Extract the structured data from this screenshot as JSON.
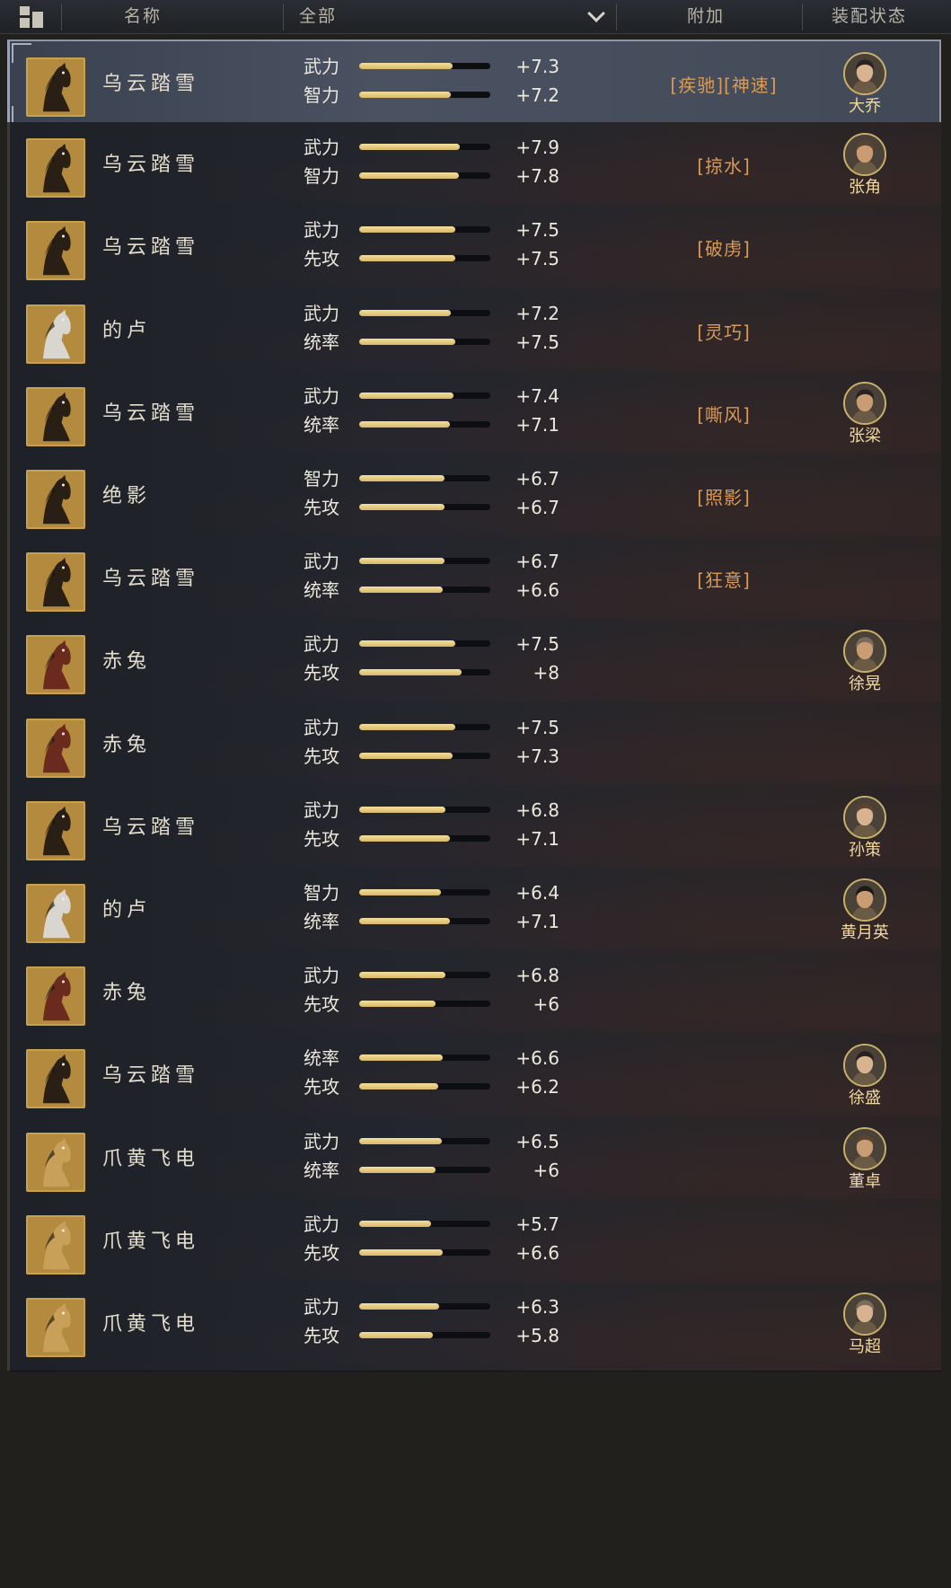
{
  "header": {
    "name_col": "名称",
    "filter_value": "全部",
    "bonus_col": "附加",
    "equip_col": "装配状态"
  },
  "horse_palette": {
    "dark": "#2a1f14",
    "white": "#d9d6cf",
    "red": "#6b2a1e",
    "yellow": "#c9a05a"
  },
  "rows": [
    {
      "name": "乌云踏雪",
      "type": "dark",
      "selected": true,
      "s1": {
        "label": "武力",
        "value": "+7.3",
        "level": 0.71
      },
      "s2": {
        "label": "智力",
        "value": "+7.2",
        "level": 0.7
      },
      "bonus": "[疾驰][神速]",
      "general": "大乔"
    },
    {
      "name": "乌云踏雪",
      "type": "dark",
      "s1": {
        "label": "武力",
        "value": "+7.9",
        "level": 0.77
      },
      "s2": {
        "label": "智力",
        "value": "+7.8",
        "level": 0.76
      },
      "bonus": "[掠水]",
      "general": "张角"
    },
    {
      "name": "乌云踏雪",
      "type": "dark",
      "s1": {
        "label": "武力",
        "value": "+7.5",
        "level": 0.73
      },
      "s2": {
        "label": "先攻",
        "value": "+7.5",
        "level": 0.73
      },
      "bonus": "[破虏]",
      "general": ""
    },
    {
      "name": "的卢",
      "type": "white",
      "s1": {
        "label": "武力",
        "value": "+7.2",
        "level": 0.7
      },
      "s2": {
        "label": "统率",
        "value": "+7.5",
        "level": 0.73
      },
      "bonus": "[灵巧]",
      "general": ""
    },
    {
      "name": "乌云踏雪",
      "type": "dark",
      "s1": {
        "label": "武力",
        "value": "+7.4",
        "level": 0.72
      },
      "s2": {
        "label": "统率",
        "value": "+7.1",
        "level": 0.69
      },
      "bonus": "[嘶风]",
      "general": "张梁"
    },
    {
      "name": "绝影",
      "type": "dark",
      "s1": {
        "label": "智力",
        "value": "+6.7",
        "level": 0.65
      },
      "s2": {
        "label": "先攻",
        "value": "+6.7",
        "level": 0.65
      },
      "bonus": "[照影]",
      "general": ""
    },
    {
      "name": "乌云踏雪",
      "type": "dark",
      "s1": {
        "label": "武力",
        "value": "+6.7",
        "level": 0.65
      },
      "s2": {
        "label": "统率",
        "value": "+6.6",
        "level": 0.64
      },
      "bonus": "[狂意]",
      "general": ""
    },
    {
      "name": "赤兔",
      "type": "red",
      "s1": {
        "label": "武力",
        "value": "+7.5",
        "level": 0.73
      },
      "s2": {
        "label": "先攻",
        "value": "+8",
        "level": 0.78
      },
      "bonus": "",
      "general": "徐晃"
    },
    {
      "name": "赤兔",
      "type": "red",
      "s1": {
        "label": "武力",
        "value": "+7.5",
        "level": 0.73
      },
      "s2": {
        "label": "先攻",
        "value": "+7.3",
        "level": 0.71
      },
      "bonus": "",
      "general": ""
    },
    {
      "name": "乌云踏雪",
      "type": "dark",
      "s1": {
        "label": "武力",
        "value": "+6.8",
        "level": 0.66
      },
      "s2": {
        "label": "先攻",
        "value": "+7.1",
        "level": 0.69
      },
      "bonus": "",
      "general": "孙策"
    },
    {
      "name": "的卢",
      "type": "white",
      "s1": {
        "label": "智力",
        "value": "+6.4",
        "level": 0.62
      },
      "s2": {
        "label": "统率",
        "value": "+7.1",
        "level": 0.69
      },
      "bonus": "",
      "general": "黄月英"
    },
    {
      "name": "赤兔",
      "type": "red",
      "s1": {
        "label": "武力",
        "value": "+6.8",
        "level": 0.66
      },
      "s2": {
        "label": "先攻",
        "value": "+6",
        "level": 0.58
      },
      "bonus": "",
      "general": ""
    },
    {
      "name": "乌云踏雪",
      "type": "dark",
      "s1": {
        "label": "统率",
        "value": "+6.6",
        "level": 0.64
      },
      "s2": {
        "label": "先攻",
        "value": "+6.2",
        "level": 0.6
      },
      "bonus": "",
      "general": "徐盛"
    },
    {
      "name": "爪黄飞电",
      "type": "yellow",
      "s1": {
        "label": "武力",
        "value": "+6.5",
        "level": 0.63
      },
      "s2": {
        "label": "统率",
        "value": "+6",
        "level": 0.58
      },
      "bonus": "",
      "general": "董卓"
    },
    {
      "name": "爪黄飞电",
      "type": "yellow",
      "s1": {
        "label": "武力",
        "value": "+5.7",
        "level": 0.55
      },
      "s2": {
        "label": "先攻",
        "value": "+6.6",
        "level": 0.64
      },
      "bonus": "",
      "general": ""
    },
    {
      "name": "爪黄飞电",
      "type": "yellow",
      "s1": {
        "label": "武力",
        "value": "+6.3",
        "level": 0.61
      },
      "s2": {
        "label": "先攻",
        "value": "+5.8",
        "level": 0.56
      },
      "bonus": "",
      "general": "马超"
    }
  ]
}
